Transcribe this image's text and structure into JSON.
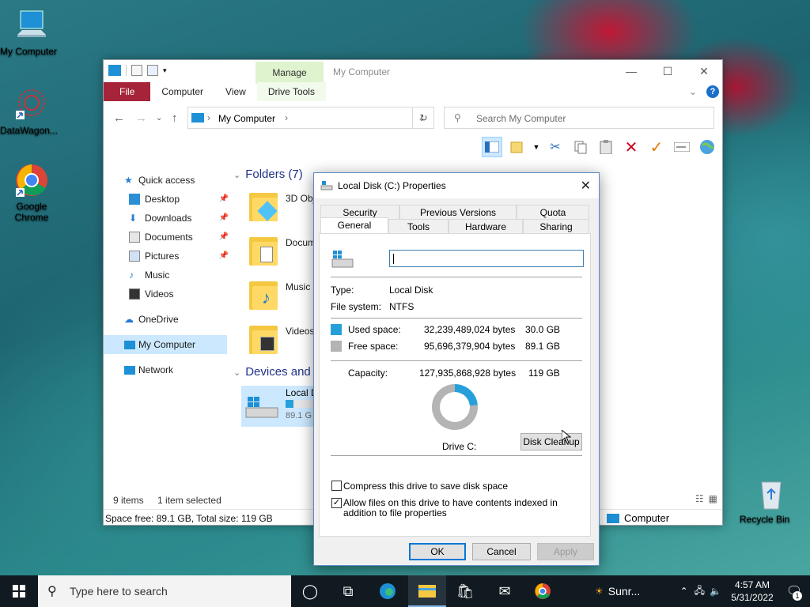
{
  "desktop": {
    "icons": [
      {
        "label": "My Computer",
        "icon": "computer-icon"
      },
      {
        "label": "DataWagon...",
        "icon": "datawagon-icon"
      },
      {
        "label": "Google Chrome",
        "icon": "chrome-icon"
      },
      {
        "label": "Recycle Bin",
        "icon": "recycle-bin-icon"
      }
    ]
  },
  "explorer": {
    "title": "My Computer",
    "contextual_tab": "Manage",
    "ribbon_tabs": [
      "File",
      "Computer",
      "View",
      "Drive Tools"
    ],
    "address": "My Computer",
    "search_placeholder": "Search My Computer",
    "nav_items": [
      {
        "label": "Quick access",
        "icon": "star-icon",
        "pinned": false
      },
      {
        "label": "Desktop",
        "icon": "desktop-folder-icon",
        "pinned": true
      },
      {
        "label": "Downloads",
        "icon": "download-icon",
        "pinned": true
      },
      {
        "label": "Documents",
        "icon": "documents-icon",
        "pinned": true
      },
      {
        "label": "Pictures",
        "icon": "pictures-icon",
        "pinned": true
      },
      {
        "label": "Music",
        "icon": "music-icon",
        "pinned": false
      },
      {
        "label": "Videos",
        "icon": "videos-icon",
        "pinned": false
      },
      {
        "label": "OneDrive",
        "icon": "cloud-icon",
        "pinned": false
      },
      {
        "label": "My Computer",
        "icon": "computer-icon",
        "pinned": false,
        "selected": true
      },
      {
        "label": "Network",
        "icon": "network-icon",
        "pinned": false
      }
    ],
    "folders_header": "Folders (7)",
    "folders": [
      "3D Obj",
      "Docum",
      "Music",
      "Videos"
    ],
    "devices_header": "Devices and",
    "drive_tile": {
      "name": "Local D",
      "free": "89.1 G",
      "used_fraction": 0.235
    },
    "status_items": "9 items",
    "status_selected": "1 item selected",
    "space_info": "Space free: 89.1 GB, Total size: 119 GB",
    "status_location": "Computer"
  },
  "dialog": {
    "title": "Local Disk (C:) Properties",
    "tabs_row1": [
      "Security",
      "Previous Versions",
      "Quota"
    ],
    "tabs_row2": [
      "General",
      "Tools",
      "Hardware",
      "Sharing"
    ],
    "active_tab": "General",
    "name_value": "",
    "type_label": "Type:",
    "type_value": "Local Disk",
    "fs_label": "File system:",
    "fs_value": "NTFS",
    "used_label": "Used space:",
    "used_bytes": "32,239,489,024 bytes",
    "used_gb": "30.0 GB",
    "free_label": "Free space:",
    "free_bytes": "95,696,379,904 bytes",
    "free_gb": "89.1 GB",
    "capacity_label": "Capacity:",
    "capacity_bytes": "127,935,868,928 bytes",
    "capacity_gb": "119 GB",
    "drive_label": "Drive C:",
    "cleanup_button": "Disk Cleanup",
    "compress_label": "Compress this drive to save disk space",
    "compress_checked": false,
    "index_label": "Allow files on this drive to have contents indexed in addition to file properties",
    "index_checked": true,
    "ok": "OK",
    "cancel": "Cancel",
    "apply": "Apply",
    "colors": {
      "used": "#26a0da",
      "free": "#b4b4b4"
    },
    "used_fraction": 0.235
  },
  "taskbar": {
    "search_placeholder": "Type here to search",
    "weather": "Sunr...",
    "time": "4:57 AM",
    "date": "5/31/2022",
    "notification_count": "1"
  }
}
